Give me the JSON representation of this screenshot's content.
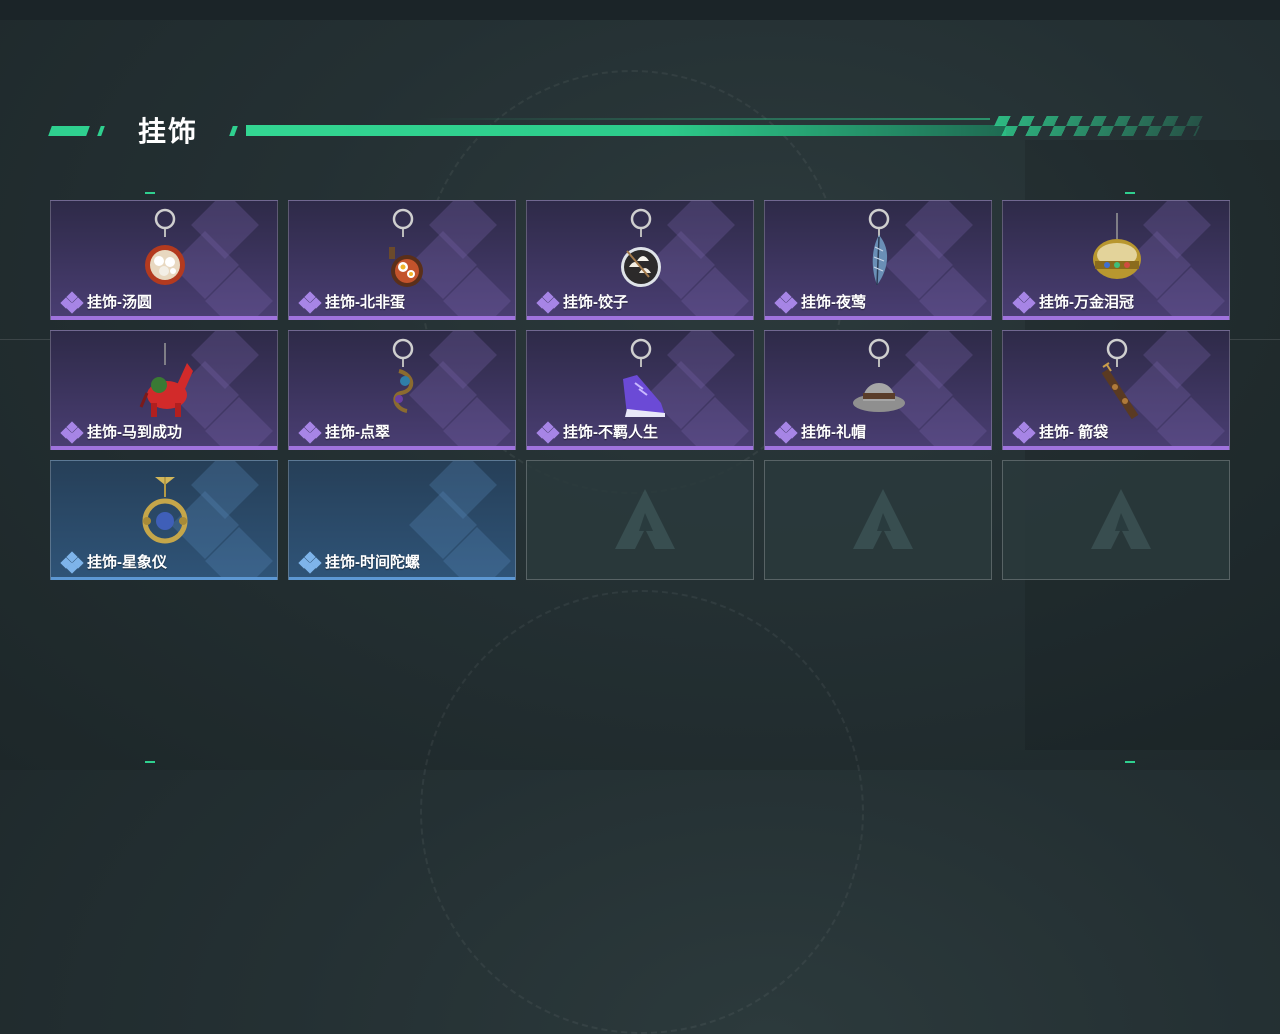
{
  "section_title": "挂饰",
  "colors": {
    "accent": "#2fd08f",
    "rare_purple": "#a073de",
    "rare_blue": "#5d98d4"
  },
  "items": [
    {
      "label": "挂饰-汤圆",
      "rarity": "purple",
      "icon": "tangyuan-bowl-icon"
    },
    {
      "label": "挂饰-北非蛋",
      "rarity": "purple",
      "icon": "shakshuka-pan-icon"
    },
    {
      "label": "挂饰-饺子",
      "rarity": "purple",
      "icon": "dumpling-plate-icon"
    },
    {
      "label": "挂饰-夜莺",
      "rarity": "purple",
      "icon": "feather-icon"
    },
    {
      "label": "挂饰-万金泪冠",
      "rarity": "purple",
      "icon": "golden-crown-icon"
    },
    {
      "label": "挂饰-马到成功",
      "rarity": "purple",
      "icon": "red-horse-icon"
    },
    {
      "label": "挂饰-点翠",
      "rarity": "purple",
      "icon": "hairpin-icon"
    },
    {
      "label": "挂饰-不羁人生",
      "rarity": "purple",
      "icon": "sneaker-icon"
    },
    {
      "label": "挂饰-礼帽",
      "rarity": "purple",
      "icon": "fedora-hat-icon"
    },
    {
      "label": "挂饰- 箭袋",
      "rarity": "purple",
      "icon": "quiver-icon"
    },
    {
      "label": "挂饰-星象仪",
      "rarity": "blue",
      "icon": "armillary-sphere-icon"
    },
    {
      "label": "挂饰-时间陀螺",
      "rarity": "blue",
      "icon": "spinning-top-icon"
    }
  ],
  "empty_slots": 3
}
